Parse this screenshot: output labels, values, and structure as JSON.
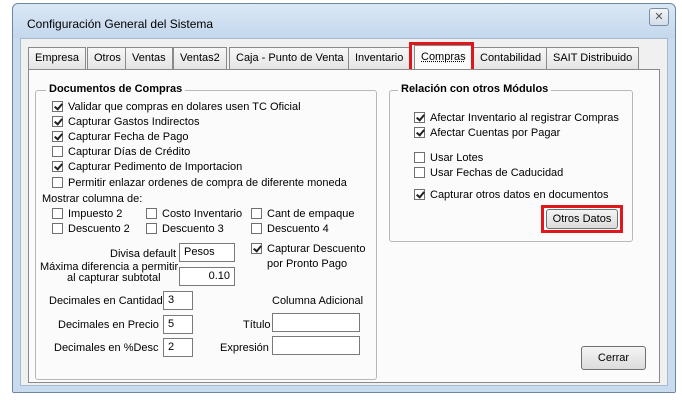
{
  "window": {
    "title": "Configuración General del Sistema",
    "close_label": "✕"
  },
  "tabs": [
    "Empresa",
    "Otros",
    "Ventas",
    "Ventas2",
    "Caja - Punto de Venta",
    "Inventario",
    "Compras",
    "Contabilidad",
    "SAIT Distribuido"
  ],
  "active_tab": "Compras",
  "documentos": {
    "title": "Documentos de Compras",
    "checks": [
      {
        "label": "Validar que compras en dolares usen TC Oficial",
        "checked": true
      },
      {
        "label": "Capturar Gastos Indirectos",
        "checked": true
      },
      {
        "label": "Capturar Fecha de Pago",
        "checked": true
      },
      {
        "label": "Capturar Días de Crédito",
        "checked": false
      },
      {
        "label": "Capturar Pedimento de Importacion",
        "checked": true
      },
      {
        "label": "Permitir enlazar ordenes de compra de diferente moneda",
        "checked": false
      }
    ],
    "mostrar_label": "Mostrar columna de:",
    "columnas": [
      {
        "label": "Impuesto 2",
        "checked": false
      },
      {
        "label": "Costo Inventario",
        "checked": false
      },
      {
        "label": "Cant de empaque",
        "checked": false
      },
      {
        "label": "Descuento 2",
        "checked": false
      },
      {
        "label": "Descuento 3",
        "checked": false
      },
      {
        "label": "Descuento 4",
        "checked": false
      }
    ],
    "divisa_label": "Divisa default",
    "divisa_value": "Pesos",
    "capturar_descuento": {
      "label_line1": "Capturar Descuento",
      "label_line2": "por Pronto Pago",
      "checked": true
    },
    "max_dif_label_line1": "Máxima diferencia a permitir",
    "max_dif_label_line2": "al capturar subtotal",
    "max_dif_value": "0.10",
    "dec_cantidad_label": "Decimales en Cantidad",
    "dec_cantidad_value": "3",
    "dec_precio_label": "Decimales en Precio",
    "dec_precio_value": "5",
    "dec_desc_label": "Decimales en %Desc",
    "dec_desc_value": "2",
    "columna_adicional_label": "Columna Adicional",
    "titulo_label": "Título",
    "titulo_value": "",
    "expresion_label": "Expresión",
    "expresion_value": ""
  },
  "relacion": {
    "title": "Relación con otros Módulos",
    "checks": [
      {
        "label": "Afectar Inventario al registrar Compras",
        "checked": true
      },
      {
        "label": "Afectar Cuentas por Pagar",
        "checked": true
      },
      {
        "label": "Usar Lotes",
        "checked": false
      },
      {
        "label": "Usar Fechas de Caducidad",
        "checked": false
      },
      {
        "label": "Capturar otros datos en documentos",
        "checked": true
      }
    ],
    "otros_datos_button": "Otros Datos"
  },
  "cerrar_button": "Cerrar",
  "highlight_color": "#e0161d"
}
